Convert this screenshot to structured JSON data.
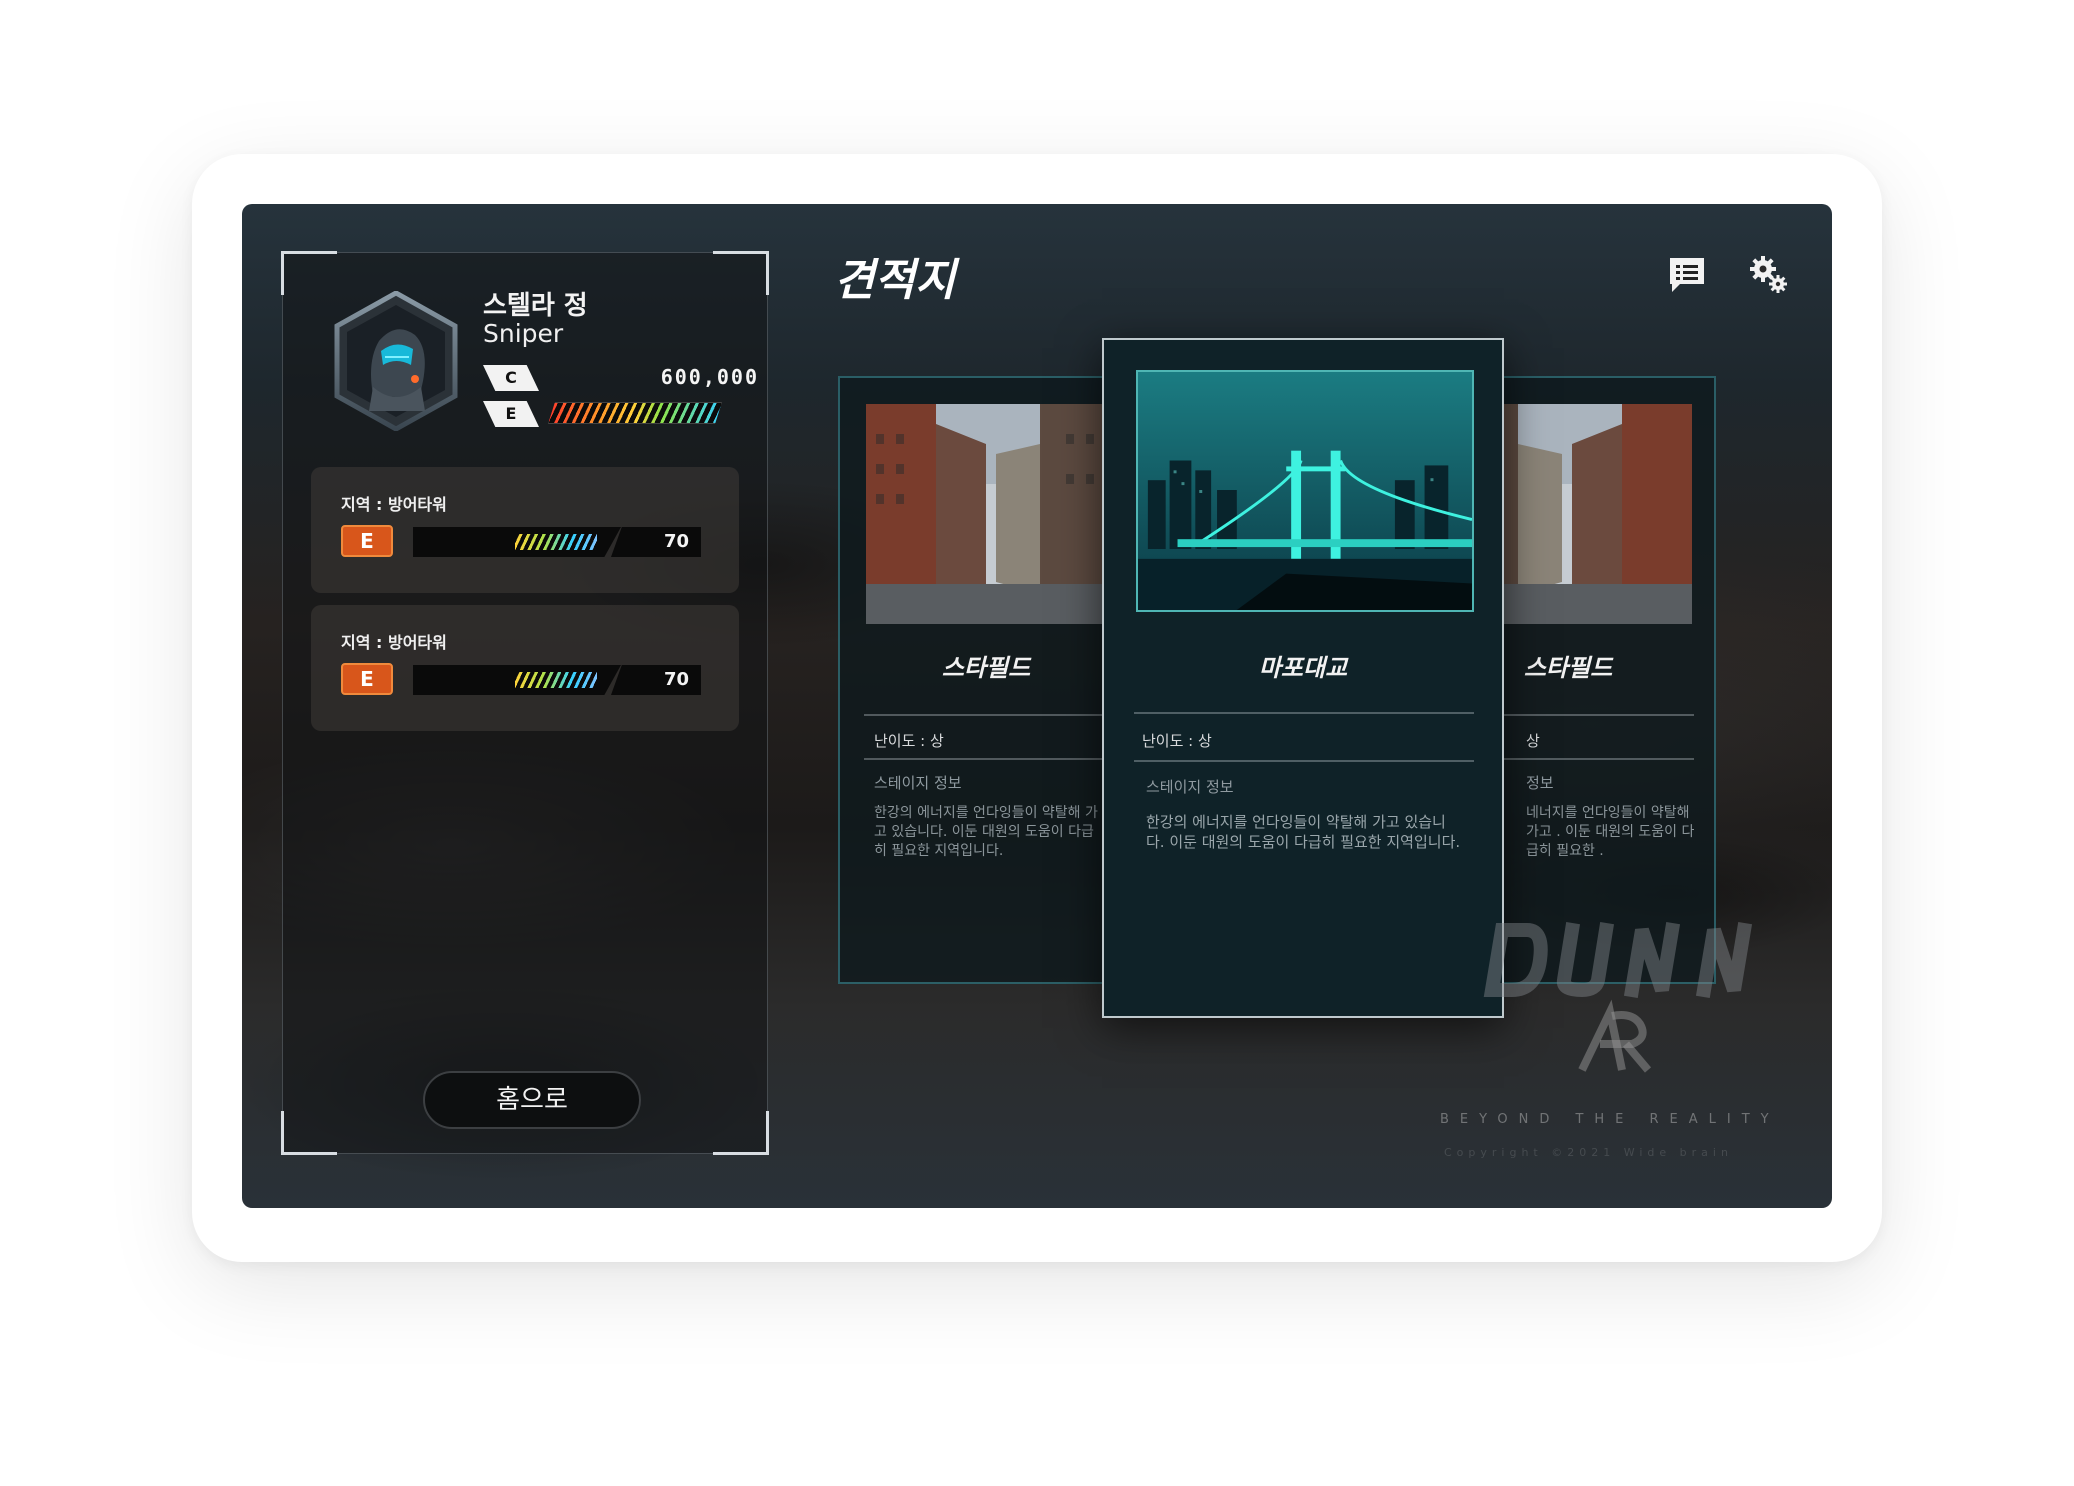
{
  "header": {
    "title": "견적지"
  },
  "player": {
    "name": "스텔라 정",
    "class": "Sniper",
    "rank_c": "C",
    "rank_e": "E",
    "currency": "600,000"
  },
  "regions": [
    {
      "label": "지역 : 방어타워",
      "grade": "E",
      "level": "70"
    },
    {
      "label": "지역 : 방어타워",
      "grade": "E",
      "level": "70"
    }
  ],
  "home_button": "홈으로",
  "stages": {
    "left": {
      "name": "스타필드",
      "difficulty": "난이도 : 상",
      "info_label": "스테이지 정보",
      "description": "한강의 에너지를 언다잉들이 약탈해 가고 있습니다. 이둔 대원의 도움이 다급히 필요한 지역입니다."
    },
    "center": {
      "name": "마포대교",
      "difficulty": "난이도 : 상",
      "info_label": "스테이지 정보",
      "description": "한강의 에너지를 언다잉들이 약탈해 가고 있습니다. 이둔 대원의 도움이 다급히 필요한 지역입니다."
    },
    "right": {
      "name": "스타필드",
      "difficulty": "상",
      "info_label": "정보",
      "description": "네너지를 언다잉들이 약탈해 가고 . 이둔 대원의 도움이 다급히 필요한 ."
    }
  },
  "brand": {
    "tagline": "BEYOND THE REALITY",
    "copyright": "Copyright ©2021 Wide brain"
  },
  "icons": {
    "chat": "chat-icon",
    "settings": "gear-icon"
  },
  "colors": {
    "accent": "#40969f",
    "grade": "#d8561b"
  }
}
